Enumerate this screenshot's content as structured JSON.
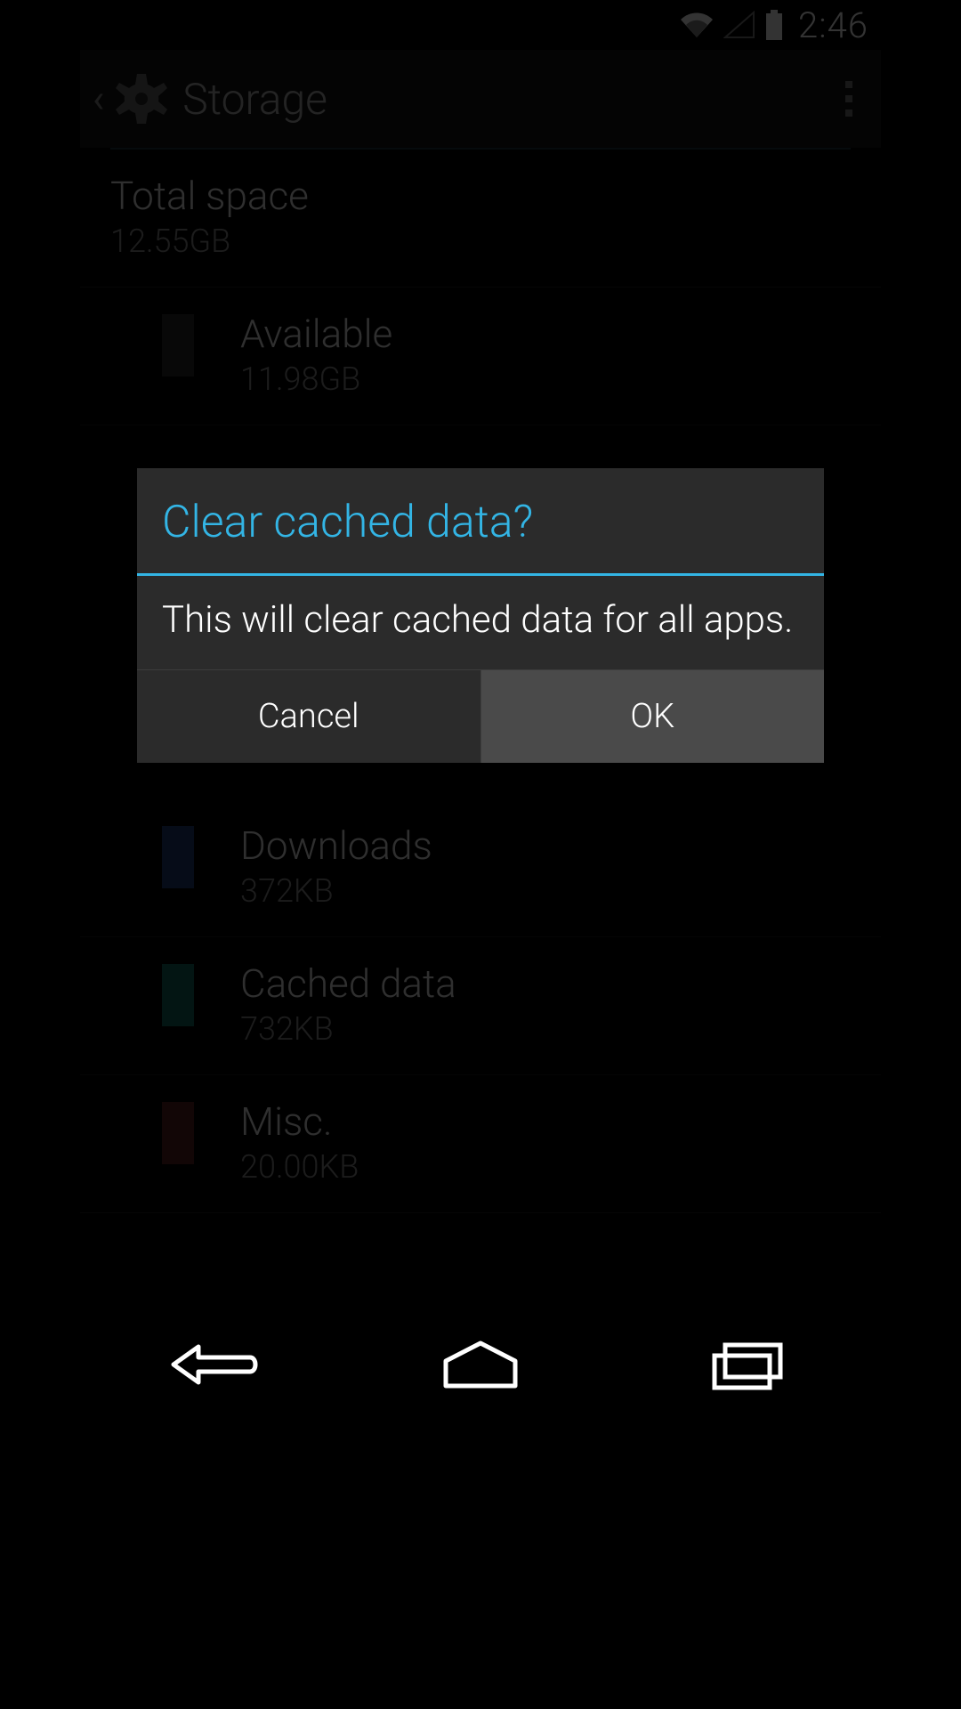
{
  "status": {
    "time": "2:46"
  },
  "header": {
    "title": "Storage"
  },
  "storage": {
    "total": {
      "label": "Total space",
      "value": "12.55GB"
    },
    "items": [
      {
        "label": "Available",
        "value": "11.98GB",
        "color": "#2a2a2a"
      },
      {
        "label": "Downloads",
        "value": "372KB",
        "color": "#1f3f78"
      },
      {
        "label": "Cached data",
        "value": "732KB",
        "color": "#0f6a60"
      },
      {
        "label": "Misc.",
        "value": "20.00KB",
        "color": "#5c1f1f"
      }
    ]
  },
  "dialog": {
    "title": "Clear cached data?",
    "body": "This will clear cached data for all apps.",
    "cancel": "Cancel",
    "ok": "OK"
  },
  "colors": {
    "accent": "#33b5e5"
  }
}
